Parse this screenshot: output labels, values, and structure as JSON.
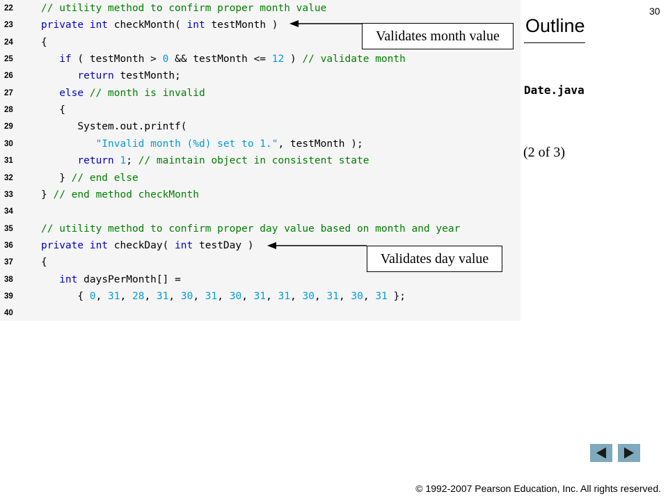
{
  "slide": {
    "page_number": "30",
    "outline_title": "Outline",
    "file_name": "Date.java",
    "part_label": "(2 of 3)",
    "copyright_symbol": "©",
    "copyright_text": " 1992-2007 Pearson Education, Inc.  All rights reserved."
  },
  "callouts": {
    "month": "Validates month value",
    "day": "Validates day value"
  },
  "nav": {
    "prev_icon": "triangle-left-icon",
    "next_icon": "triangle-right-icon",
    "button_color": "#7fa9bc",
    "arrow_color": "#1a1a1a"
  },
  "colors": {
    "keyword": "#0000c8",
    "comment": "#008000",
    "literal": "#009cd8",
    "code_background": "#f5f5f5"
  },
  "code_lines": [
    {
      "num": "22",
      "tokens": [
        [
          "cm",
          "// utility method to confirm proper month value"
        ]
      ]
    },
    {
      "num": "23",
      "tokens": [
        [
          "kw",
          "private"
        ],
        [
          "p",
          " "
        ],
        [
          "kw",
          "int"
        ],
        [
          "p",
          " checkMonth( "
        ],
        [
          "kw",
          "int"
        ],
        [
          "p",
          " testMonth )"
        ]
      ]
    },
    {
      "num": "24",
      "tokens": [
        [
          "p",
          "{"
        ]
      ]
    },
    {
      "num": "25",
      "tokens": [
        [
          "p",
          "   "
        ],
        [
          "kw",
          "if"
        ],
        [
          "p",
          " ( testMonth > "
        ],
        [
          "num",
          "0"
        ],
        [
          "p",
          " && testMonth <= "
        ],
        [
          "num",
          "12"
        ],
        [
          "p",
          " ) "
        ],
        [
          "cm",
          "// validate month"
        ]
      ]
    },
    {
      "num": "26",
      "tokens": [
        [
          "p",
          "      "
        ],
        [
          "kw",
          "return"
        ],
        [
          "p",
          " testMonth;"
        ]
      ]
    },
    {
      "num": "27",
      "tokens": [
        [
          "p",
          "   "
        ],
        [
          "kw",
          "else"
        ],
        [
          "p",
          " "
        ],
        [
          "cm",
          "// month is invalid"
        ]
      ]
    },
    {
      "num": "28",
      "tokens": [
        [
          "p",
          "   {"
        ]
      ]
    },
    {
      "num": "29",
      "tokens": [
        [
          "p",
          "      System.out.printf("
        ]
      ]
    },
    {
      "num": "30",
      "tokens": [
        [
          "p",
          "         "
        ],
        [
          "str",
          "\"Invalid month (%d) set to 1.\""
        ],
        [
          "p",
          ", testMonth );"
        ]
      ]
    },
    {
      "num": "31",
      "tokens": [
        [
          "p",
          "      "
        ],
        [
          "kw",
          "return"
        ],
        [
          "p",
          " "
        ],
        [
          "num",
          "1"
        ],
        [
          "p",
          "; "
        ],
        [
          "cm",
          "// maintain object in consistent state"
        ]
      ]
    },
    {
      "num": "32",
      "tokens": [
        [
          "p",
          "   } "
        ],
        [
          "cm",
          "// end else"
        ]
      ]
    },
    {
      "num": "33",
      "tokens": [
        [
          "p",
          "} "
        ],
        [
          "cm",
          "// end method checkMonth"
        ]
      ]
    },
    {
      "num": "34",
      "tokens": []
    },
    {
      "num": "35",
      "tokens": [
        [
          "cm",
          "// utility method to confirm proper day value based on month and year"
        ]
      ]
    },
    {
      "num": "36",
      "tokens": [
        [
          "kw",
          "private"
        ],
        [
          "p",
          " "
        ],
        [
          "kw",
          "int"
        ],
        [
          "p",
          " checkDay( "
        ],
        [
          "kw",
          "int"
        ],
        [
          "p",
          " testDay )"
        ]
      ]
    },
    {
      "num": "37",
      "tokens": [
        [
          "p",
          "{"
        ]
      ]
    },
    {
      "num": "38",
      "tokens": [
        [
          "p",
          "   "
        ],
        [
          "kw",
          "int"
        ],
        [
          "p",
          " daysPerMonth[] ="
        ]
      ]
    },
    {
      "num": "39",
      "tokens": [
        [
          "p",
          "      { "
        ],
        [
          "num",
          "0"
        ],
        [
          "p",
          ", "
        ],
        [
          "num",
          "31"
        ],
        [
          "p",
          ", "
        ],
        [
          "num",
          "28"
        ],
        [
          "p",
          ", "
        ],
        [
          "num",
          "31"
        ],
        [
          "p",
          ", "
        ],
        [
          "num",
          "30"
        ],
        [
          "p",
          ", "
        ],
        [
          "num",
          "31"
        ],
        [
          "p",
          ", "
        ],
        [
          "num",
          "30"
        ],
        [
          "p",
          ", "
        ],
        [
          "num",
          "31"
        ],
        [
          "p",
          ", "
        ],
        [
          "num",
          "31"
        ],
        [
          "p",
          ", "
        ],
        [
          "num",
          "30"
        ],
        [
          "p",
          ", "
        ],
        [
          "num",
          "31"
        ],
        [
          "p",
          ", "
        ],
        [
          "num",
          "30"
        ],
        [
          "p",
          ", "
        ],
        [
          "num",
          "31"
        ],
        [
          "p",
          " };"
        ]
      ]
    },
    {
      "num": "40",
      "tokens": []
    }
  ]
}
